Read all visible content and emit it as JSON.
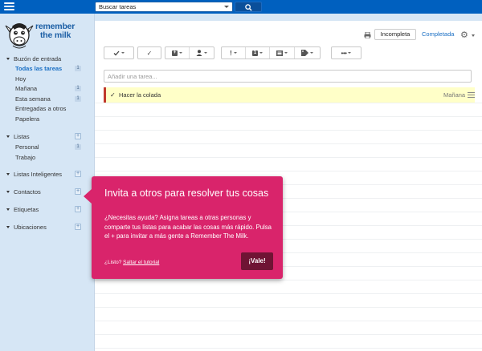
{
  "colors": {
    "topbar": "#0060bf",
    "sidebar": "#d6e6f5",
    "accent": "#1a6fc4",
    "tooltip": "#d9246b",
    "ok_button": "#6f1434",
    "task_highlight": "#ffffc8",
    "priority": "#c0392b"
  },
  "header": {
    "menu_icon": "hamburger-icon",
    "search": {
      "placeholder": "Buscar tareas"
    },
    "search_icon": "magnifier-icon"
  },
  "logo": {
    "line1": "remember",
    "line2": "the milk"
  },
  "sidebar": {
    "inbox": {
      "label": "Buzón de entrada",
      "items": [
        {
          "label": "Todas las tareas",
          "count": "1"
        },
        {
          "label": "Hoy",
          "count": ""
        },
        {
          "label": "Mañana",
          "count": "1"
        },
        {
          "label": "Esta semana",
          "count": "1"
        },
        {
          "label": "Entregadas a otros",
          "count": ""
        },
        {
          "label": "Papelera",
          "count": ""
        }
      ]
    },
    "lists": {
      "label": "Listas",
      "add": "+",
      "items": [
        {
          "label": "Personal",
          "count": "1"
        },
        {
          "label": "Trabajo",
          "count": ""
        }
      ]
    },
    "smart_lists": {
      "label": "Listas Inteligentes",
      "add": "+"
    },
    "contacts": {
      "label": "Contactos",
      "add": "+"
    },
    "tags": {
      "label": "Etiquetas",
      "add": "+"
    },
    "locations": {
      "label": "Ubicaciones",
      "add": "+"
    }
  },
  "main": {
    "tabs": {
      "incomplete": "Incompleta",
      "complete": "Completada"
    },
    "toolbar": {
      "complete": "✓",
      "priority": "!",
      "more": "•••"
    },
    "add_task": {
      "placeholder": "Añadir una tarea..."
    },
    "tasks": [
      {
        "name": "Hacer la colada",
        "due": "Mañana"
      }
    ]
  },
  "tooltip": {
    "title": "Invita a otros para resolver tus cosas",
    "body": "¿Necesitas ayuda? Asigna tareas a otras personas y comparte tus listas para acabar las cosas más rápido. Pulsa el + para invitar a más gente a Remember The Milk.",
    "ready": "¿Listo?",
    "skip": "Saltar el tutorial",
    "ok": "¡Vale!"
  }
}
